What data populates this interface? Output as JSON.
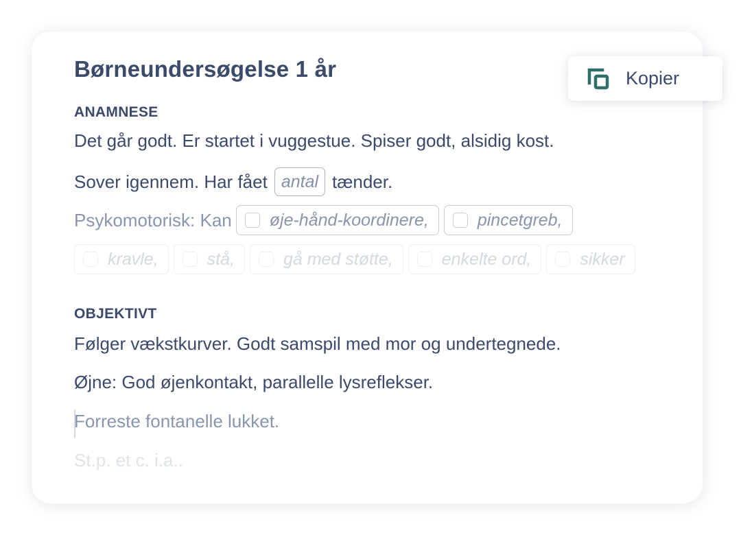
{
  "card": {
    "title": "Børneundersøgelse 1 år"
  },
  "copy_button": {
    "label": "Kopier",
    "icon": "copy-icon",
    "icon_color": "#2f6f6a"
  },
  "anamnese": {
    "heading": "ANAMNESE",
    "line1": "Det går godt. Er startet i vuggestue. Spiser godt, alsidig kost.",
    "line2_before": "Sover igennem. Har fået",
    "line2_field": "antal",
    "line2_after": "tænder.",
    "psyko_label": "Psykomotorisk: Kan",
    "options": [
      "øje-hånd-koordinere,",
      "pincetgreb,",
      "kravle,",
      "stå,",
      "gå med støtte,",
      "enkelte ord,",
      "sikker"
    ]
  },
  "objektivt": {
    "heading": "OBJEKTIVT",
    "line1": "Følger vækstkurver. Godt samspil med mor og undertegnede.",
    "line2": "Øjne: God øjenkontakt, parallelle lysreflekser.",
    "line3": "Forreste fontanelle lukket.",
    "line4": "St.p. et c. i.a.."
  }
}
